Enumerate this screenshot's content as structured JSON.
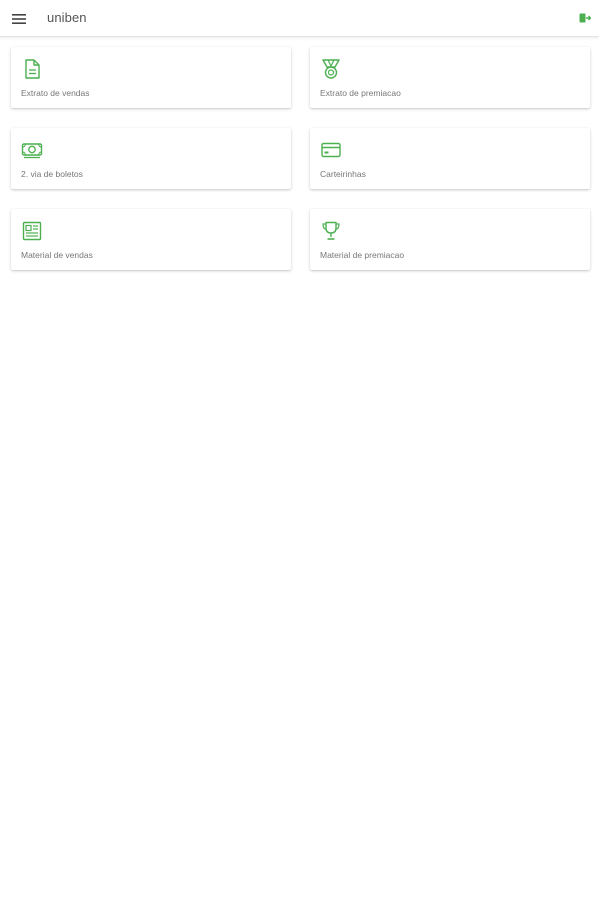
{
  "header": {
    "title": "uniben"
  },
  "colors": {
    "accent": "#4caf50",
    "text": "#555555",
    "label": "#777777"
  },
  "cards": [
    {
      "label": "Extrato de vendas",
      "icon": "document-icon"
    },
    {
      "label": "Extrato de premiacao",
      "icon": "medal-icon"
    },
    {
      "label": "2. via de boletos",
      "icon": "money-icon"
    },
    {
      "label": "Carteirinhas",
      "icon": "credit-card-icon"
    },
    {
      "label": "Material de vendas",
      "icon": "newspaper-icon"
    },
    {
      "label": "Material de premiacao",
      "icon": "trophy-icon"
    }
  ]
}
